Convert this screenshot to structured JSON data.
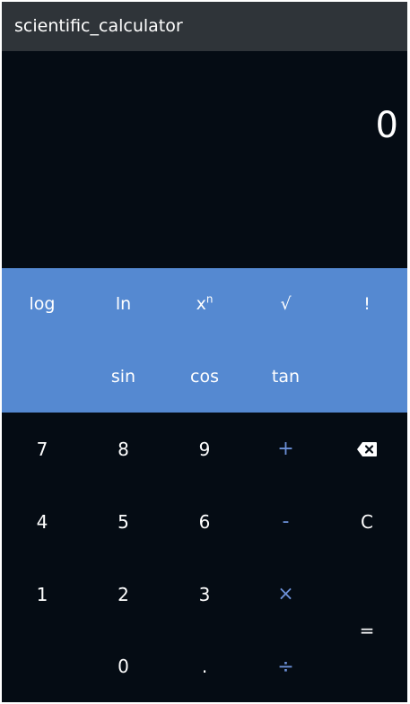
{
  "app": {
    "title": "scientific_calculator"
  },
  "display": {
    "value": "0"
  },
  "scientific": {
    "log": "log",
    "ln": "ln",
    "power_base": "x",
    "power_exp": "n",
    "sqrt": "√",
    "factorial": "!",
    "sin": "sin",
    "cos": "cos",
    "tan": "tan"
  },
  "keypad": {
    "seven": "7",
    "eight": "8",
    "nine": "9",
    "four": "4",
    "five": "5",
    "six": "6",
    "one": "1",
    "two": "2",
    "three": "3",
    "zero": "0",
    "dot": ".",
    "plus": "+",
    "minus": "-",
    "multiply": "×",
    "divide": "÷",
    "clear": "C",
    "equals": "=",
    "backspace_icon": "backspace-icon"
  },
  "colors": {
    "title_bar": "#2f3439",
    "background": "#050c14",
    "scientific_panel": "#5589d1",
    "operator_text": "#6b8fd6",
    "text": "#ffffff"
  }
}
